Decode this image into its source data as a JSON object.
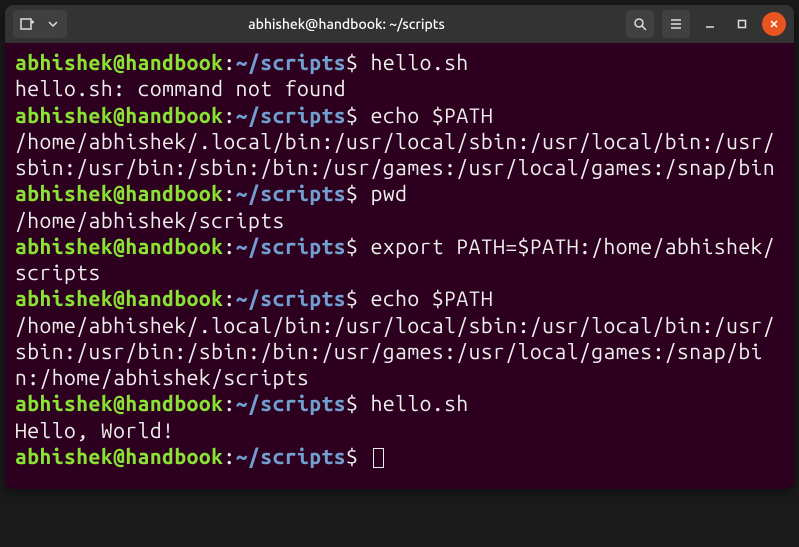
{
  "window": {
    "title": "abhishek@handbook: ~/scripts"
  },
  "prompt": {
    "user_host": "abhishek@handbook",
    "colon": ":",
    "path": "~/scripts",
    "symbol": "$"
  },
  "lines": [
    {
      "type": "prompt",
      "command": "hello.sh"
    },
    {
      "type": "output",
      "text": "hello.sh: command not found"
    },
    {
      "type": "prompt",
      "command": "echo $PATH"
    },
    {
      "type": "output",
      "text": "/home/abhishek/.local/bin:/usr/local/sbin:/usr/local/bin:/usr/sbin:/usr/bin:/sbin:/bin:/usr/games:/usr/local/games:/snap/bin"
    },
    {
      "type": "prompt",
      "command": "pwd"
    },
    {
      "type": "output",
      "text": "/home/abhishek/scripts"
    },
    {
      "type": "prompt",
      "command": "export PATH=$PATH:/home/abhishek/scripts"
    },
    {
      "type": "prompt",
      "command": "echo $PATH"
    },
    {
      "type": "output",
      "text": "/home/abhishek/.local/bin:/usr/local/sbin:/usr/local/bin:/usr/sbin:/usr/bin:/sbin:/bin:/usr/games:/usr/local/games:/snap/bin:/home/abhishek/scripts"
    },
    {
      "type": "prompt",
      "command": "hello.sh"
    },
    {
      "type": "output",
      "text": "Hello, World!"
    },
    {
      "type": "prompt",
      "command": "",
      "cursor": true
    }
  ]
}
